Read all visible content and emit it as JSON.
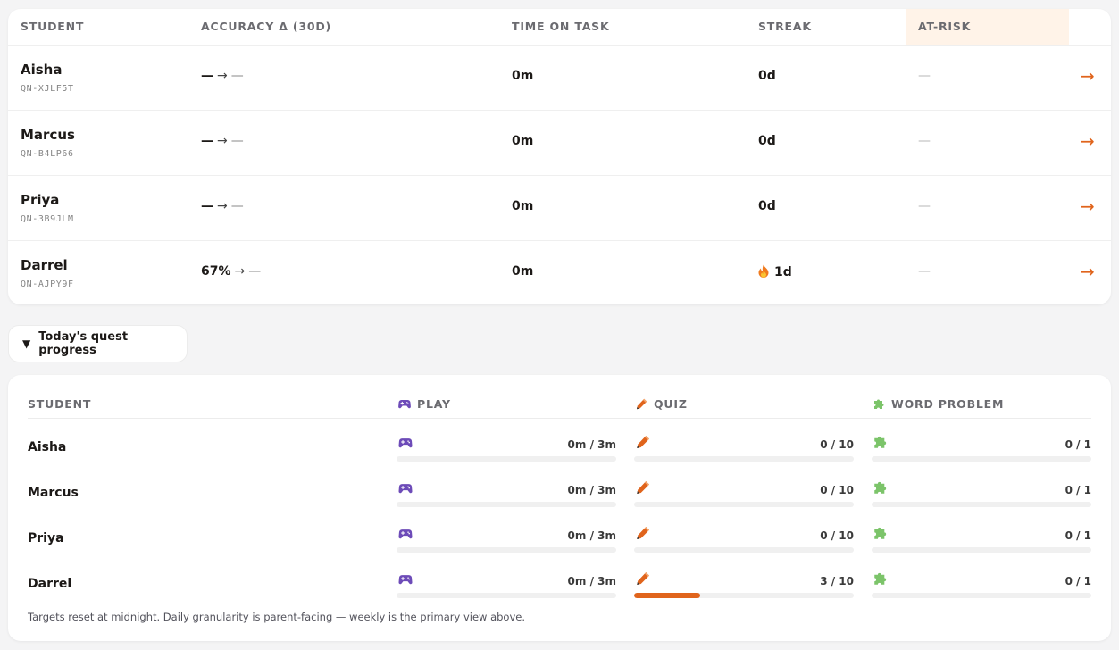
{
  "top_table": {
    "headers": {
      "student": "STUDENT",
      "accuracy": "ACCURACY Δ (30D)",
      "time": "TIME ON TASK",
      "streak": "STREAK",
      "atrisk": "AT-RISK"
    },
    "rows": [
      {
        "name": "Aisha",
        "code": "QN-XJLF5T",
        "acc_from": "—",
        "acc_arrow": "→",
        "acc_to": "—",
        "time": "0m",
        "streak": "0d",
        "streak_flame": false,
        "atrisk": "—",
        "action": "→"
      },
      {
        "name": "Marcus",
        "code": "QN-B4LP66",
        "acc_from": "—",
        "acc_arrow": "→",
        "acc_to": "—",
        "time": "0m",
        "streak": "0d",
        "streak_flame": false,
        "atrisk": "—",
        "action": "→"
      },
      {
        "name": "Priya",
        "code": "QN-3B9JLM",
        "acc_from": "—",
        "acc_arrow": "→",
        "acc_to": "—",
        "time": "0m",
        "streak": "0d",
        "streak_flame": false,
        "atrisk": "—",
        "action": "→"
      },
      {
        "name": "Darrel",
        "code": "QN-AJPY9F",
        "acc_from": "67%",
        "acc_arrow": "→",
        "acc_to": "—",
        "time": "0m",
        "streak": "1d",
        "streak_flame": true,
        "atrisk": "—",
        "action": "→"
      }
    ]
  },
  "quest_toggle": {
    "caret": "▼",
    "label": "Today's quest progress"
  },
  "quest_table": {
    "headers": {
      "student": "STUDENT",
      "play": "PLAY",
      "quiz": "QUIZ",
      "word_problem": "WORD PROBLEM"
    },
    "icons": {
      "play": "gamepad-icon",
      "quiz": "pencil-icon",
      "word_problem": "puzzle-icon"
    },
    "rows": [
      {
        "name": "Aisha",
        "play": {
          "text": "0m / 3m",
          "progress": 0
        },
        "quiz": {
          "text": "0 / 10",
          "progress": 0
        },
        "word_problem": {
          "text": "0 / 1",
          "progress": 0
        }
      },
      {
        "name": "Marcus",
        "play": {
          "text": "0m / 3m",
          "progress": 0
        },
        "quiz": {
          "text": "0 / 10",
          "progress": 0
        },
        "word_problem": {
          "text": "0 / 1",
          "progress": 0
        }
      },
      {
        "name": "Priya",
        "play": {
          "text": "0m / 3m",
          "progress": 0
        },
        "quiz": {
          "text": "0 / 10",
          "progress": 0
        },
        "word_problem": {
          "text": "0 / 1",
          "progress": 0
        }
      },
      {
        "name": "Darrel",
        "play": {
          "text": "0m / 3m",
          "progress": 0
        },
        "quiz": {
          "text": "3 / 10",
          "progress": 0.3
        },
        "word_problem": {
          "text": "0 / 1",
          "progress": 0
        }
      }
    ],
    "footnote": "Targets reset at midnight. Daily granularity is parent-facing — weekly is the primary view above."
  },
  "colors": {
    "accent": "#e0641c",
    "atrisk_header_bg": "#fff3e8",
    "track": "#f0f0f0"
  }
}
